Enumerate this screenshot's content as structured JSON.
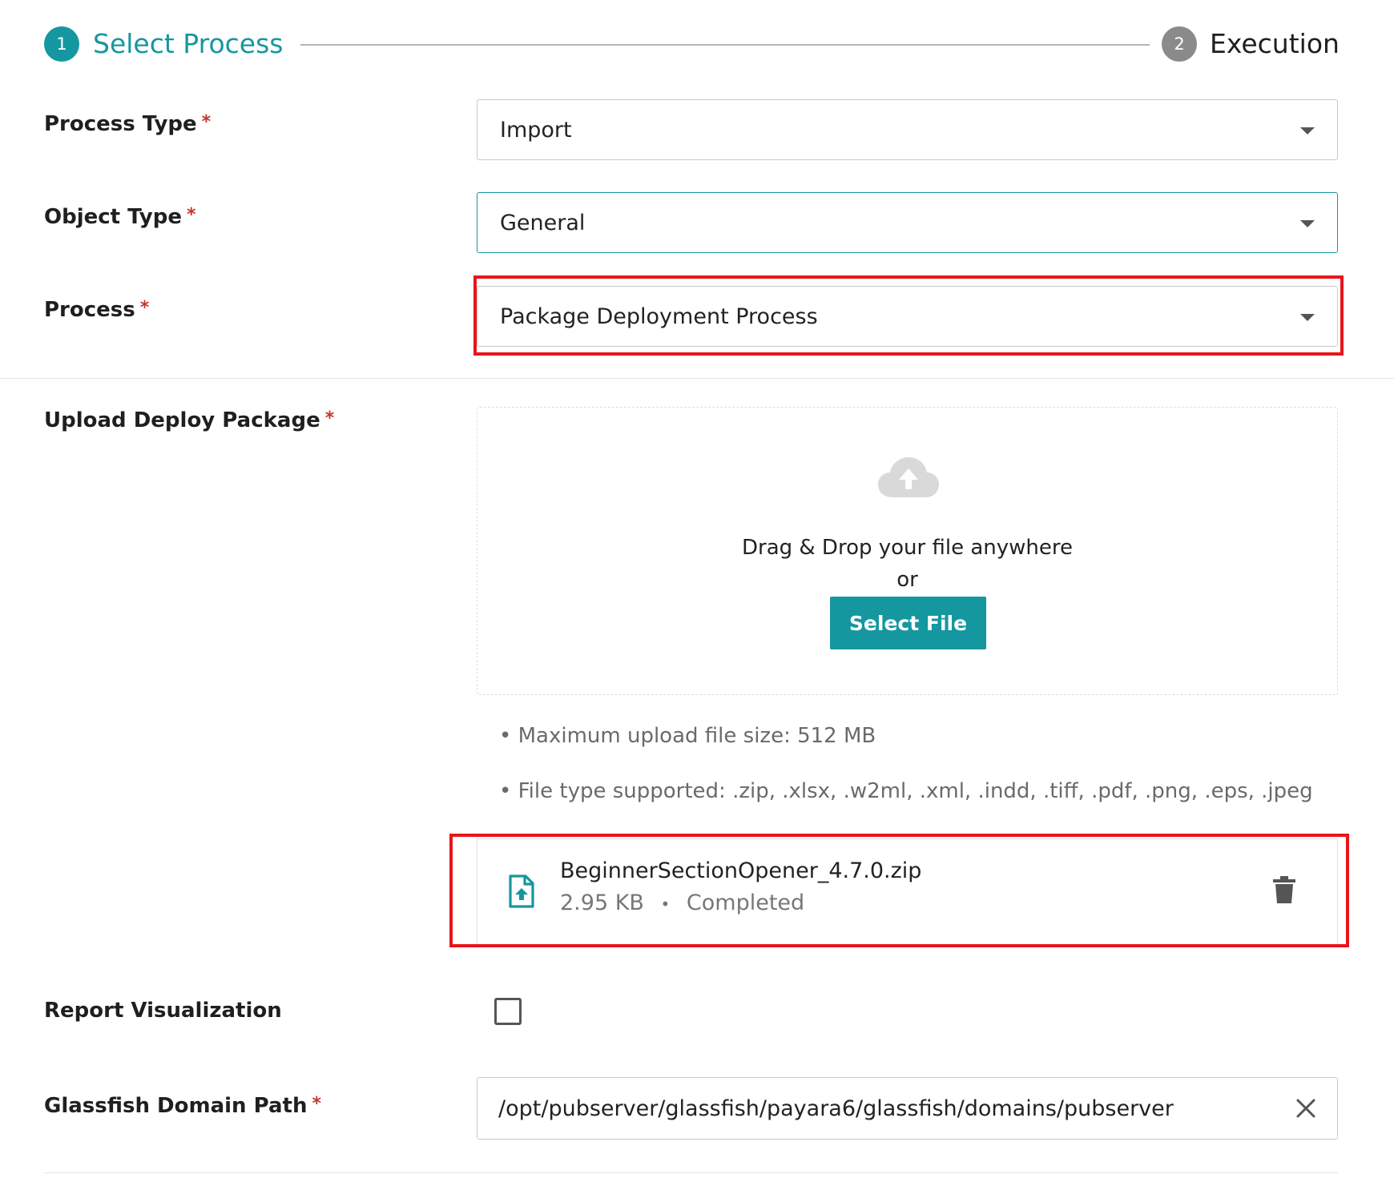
{
  "stepper": {
    "steps": [
      {
        "number": "1",
        "label": "Select Process",
        "state": "active"
      },
      {
        "number": "2",
        "label": "Execution",
        "state": "inactive"
      }
    ]
  },
  "colors": {
    "accent": "#1597a0",
    "highlight": "#e8151b",
    "required": "#c0392b"
  },
  "form": {
    "process_type": {
      "label": "Process Type",
      "required_mark": "*",
      "value": "Import"
    },
    "object_type": {
      "label": "Object Type",
      "required_mark": "*",
      "value": "General"
    },
    "process": {
      "label": "Process",
      "required_mark": "*",
      "value": "Package Deployment Process"
    },
    "upload": {
      "label": "Upload Deploy Package",
      "required_mark": "*",
      "icon": "cloud-upload-icon",
      "drag_text": "Drag & Drop your file anywhere",
      "or_text": "or",
      "button_label": "Select File",
      "hints": [
        "• Maximum upload file size: 512 MB",
        "• File type supported: .zip, .xlsx, .w2ml, .xml, .indd, .tiff, .pdf, .png, .eps, .jpeg"
      ],
      "file": {
        "name": "BeginnerSectionOpener_4.7.0.zip",
        "size": "2.95 KB",
        "separator": "•",
        "status": "Completed",
        "icon": "file-upload-icon",
        "delete_icon": "trash-icon"
      }
    },
    "report_visualization": {
      "label": "Report Visualization",
      "checked": false
    },
    "glassfish_path": {
      "label": "Glassfish Domain Path",
      "required_mark": "*",
      "value": "/opt/pubserver/glassfish/payara6/glassfish/domains/pubserver",
      "clear_icon": "close-icon"
    }
  }
}
